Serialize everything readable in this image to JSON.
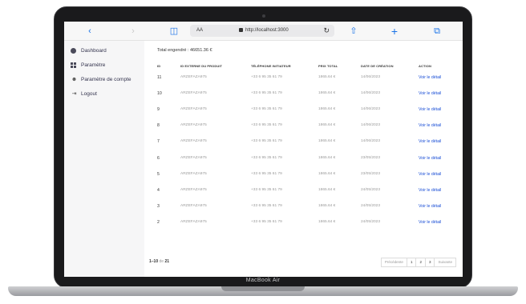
{
  "device": {
    "label": "MacBook Air"
  },
  "browser": {
    "url": "http://localhost:3000",
    "aa_label": "AA",
    "icons": {
      "back": "chevron-left",
      "forward": "chevron-right",
      "bookmarks": "book",
      "reload": "reload",
      "share": "share",
      "new_tab": "plus",
      "tabs": "tabs"
    }
  },
  "sidebar": {
    "items": [
      {
        "label": "Dashboard",
        "icon": "pie-chart-icon"
      },
      {
        "label": "Paramètre",
        "icon": "grid-icon"
      },
      {
        "label": "Paramètre de compte",
        "icon": "users-icon"
      },
      {
        "label": "Logout",
        "icon": "logout-icon"
      }
    ]
  },
  "main": {
    "total_label": "Total engendré : 46651.36 €",
    "headers": [
      "ID",
      "ID EXTERNE DU PRODUIT",
      "TÉLÉPHONE INITIATEUR",
      "PRIX TOTAL",
      "DATE DE CRÉATION",
      "ACTION"
    ],
    "rows": [
      {
        "id": "11",
        "ext": "ARZEFAZA975",
        "phone": "+33 6 95 35 61 79",
        "price": "1865.64 €",
        "date": "14/06/2023",
        "action": "Voir le détail"
      },
      {
        "id": "10",
        "ext": "ARZEFAZA975",
        "phone": "+33 6 95 35 61 79",
        "price": "1865.64 €",
        "date": "14/06/2023",
        "action": "Voir le détail"
      },
      {
        "id": "9",
        "ext": "ARZEFAZA975",
        "phone": "+33 6 95 35 61 79",
        "price": "1865.64 €",
        "date": "14/06/2023",
        "action": "Voir le détail"
      },
      {
        "id": "8",
        "ext": "ARZEFAZA975",
        "phone": "+33 6 95 35 61 79",
        "price": "1865.64 €",
        "date": "14/06/2023",
        "action": "Voir le détail"
      },
      {
        "id": "7",
        "ext": "ARZEFAZA975",
        "phone": "+33 6 95 35 61 79",
        "price": "1865.64 €",
        "date": "14/06/2023",
        "action": "Voir le détail"
      },
      {
        "id": "6",
        "ext": "ARZEFAZA975",
        "phone": "+33 6 95 35 61 79",
        "price": "1865.64 €",
        "date": "23/05/2023",
        "action": "Voir le détail"
      },
      {
        "id": "5",
        "ext": "ARZEFAZA975",
        "phone": "+33 6 95 35 61 79",
        "price": "1865.64 €",
        "date": "23/05/2023",
        "action": "Voir le détail"
      },
      {
        "id": "4",
        "ext": "ARZEFAZA975",
        "phone": "+33 6 95 35 61 79",
        "price": "1865.64 €",
        "date": "24/05/2023",
        "action": "Voir le détail"
      },
      {
        "id": "3",
        "ext": "ARZEFAZA975",
        "phone": "+33 6 95 35 61 79",
        "price": "1865.64 €",
        "date": "24/05/2023",
        "action": "Voir le détail"
      },
      {
        "id": "2",
        "ext": "ARZEFAZA975",
        "phone": "+33 6 95 35 61 79",
        "price": "1865.64 €",
        "date": "24/05/2023",
        "action": "Voir le détail"
      }
    ]
  },
  "pagination": {
    "range": "1–10",
    "of_label": "de",
    "total": "21",
    "prev": "Précédente",
    "pages": [
      "1",
      "2",
      "3"
    ],
    "next": "Suivante"
  }
}
